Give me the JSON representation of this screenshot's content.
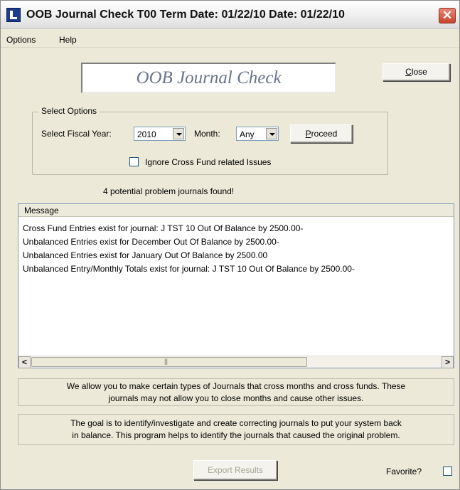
{
  "window": {
    "title": "OOB Journal Check   T00  Term Date: 01/22/10  Date: 01/22/10"
  },
  "menu": {
    "options": "Options",
    "help": "Help"
  },
  "banner": {
    "text": "OOB Journal Check"
  },
  "close_button": {
    "label_mnemonic": "C",
    "label_rest": "lose"
  },
  "select_options": {
    "legend": "Select Options",
    "fiscal_year_label": "Select Fiscal Year:",
    "fiscal_year_value": "2010",
    "month_label": "Month:",
    "month_value": "Any",
    "proceed_mnemonic": "P",
    "proceed_rest": "roceed",
    "ignore_cross_fund_label": "Ignore Cross Fund related Issues"
  },
  "status": {
    "message": "4 potential problem journals found!"
  },
  "message_list": {
    "header": "Message",
    "rows": [
      "Cross Fund Entries exist for journal: J TST  10 Out Of Balance by 2500.00-",
      "Unbalanced Entries exist for December Out Of Balance by 2500.00-",
      "Unbalanced Entries exist for January Out Of Balance by 2500.00",
      "Unbalanced Entry/Monthly Totals exist for journal: J TST  10 Out Of Balance by 2500.00-"
    ]
  },
  "notes": {
    "note1_line1": "We allow you to make certain types of Journals that cross months and cross funds.  These",
    "note1_line2": "journals may not allow you to close months and cause other issues.",
    "note2_line1": "The goal is to identify/investigate and create correcting journals to put your system back",
    "note2_line2": "in balance.  This program helps to identify the journals that caused the original problem."
  },
  "footer": {
    "export_label": "Export Results",
    "favorite_label": "Favorite?"
  }
}
